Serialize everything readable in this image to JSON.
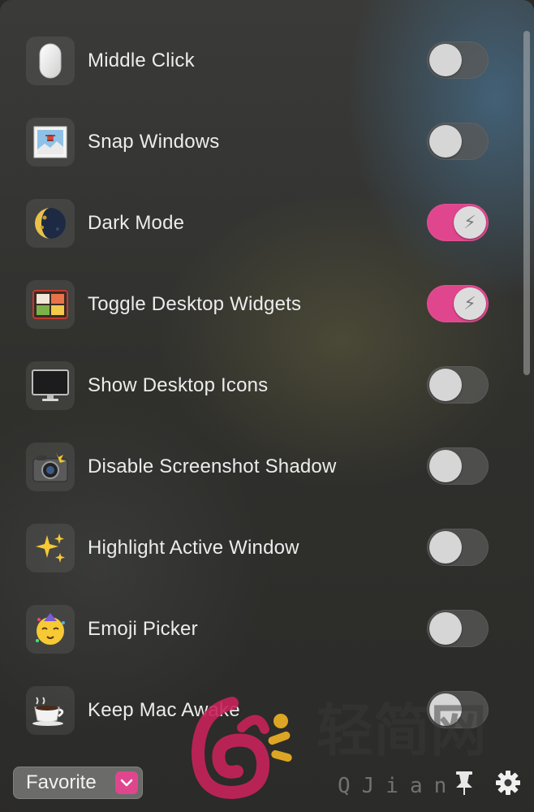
{
  "items": [
    {
      "label": "Middle Click",
      "on": false,
      "icon": "mouse-icon"
    },
    {
      "label": "Snap Windows",
      "on": false,
      "icon": "snap-windows-icon"
    },
    {
      "label": "Dark Mode",
      "on": true,
      "icon": "moon-icon"
    },
    {
      "label": "Toggle Desktop Widgets",
      "on": true,
      "icon": "bento-box-icon"
    },
    {
      "label": "Show Desktop Icons",
      "on": false,
      "icon": "monitor-icon"
    },
    {
      "label": "Disable Screenshot Shadow",
      "on": false,
      "icon": "camera-flash-icon"
    },
    {
      "label": "Highlight Active Window",
      "on": false,
      "icon": "sparkles-icon"
    },
    {
      "label": "Emoji Picker",
      "on": false,
      "icon": "party-face-icon"
    },
    {
      "label": "Keep Mac Awake",
      "on": false,
      "icon": "coffee-icon"
    }
  ],
  "footer": {
    "favorite_label": "Favorite"
  },
  "watermark": {
    "text": "轻简网",
    "sub": "QJian"
  },
  "colors": {
    "accent": "#e0468d",
    "toggle_off": "#5a5a58"
  }
}
